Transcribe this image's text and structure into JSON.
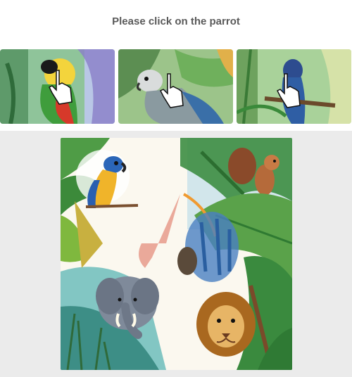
{
  "challenge": {
    "prompt": "Please click on the parrot"
  },
  "thumbnails": [
    {
      "icon": "parrot-watercolor"
    },
    {
      "icon": "parrot-grey-leaves"
    },
    {
      "icon": "parrot-blue-branch"
    }
  ],
  "scene": {
    "icon": "jungle-watercolor-scene"
  }
}
